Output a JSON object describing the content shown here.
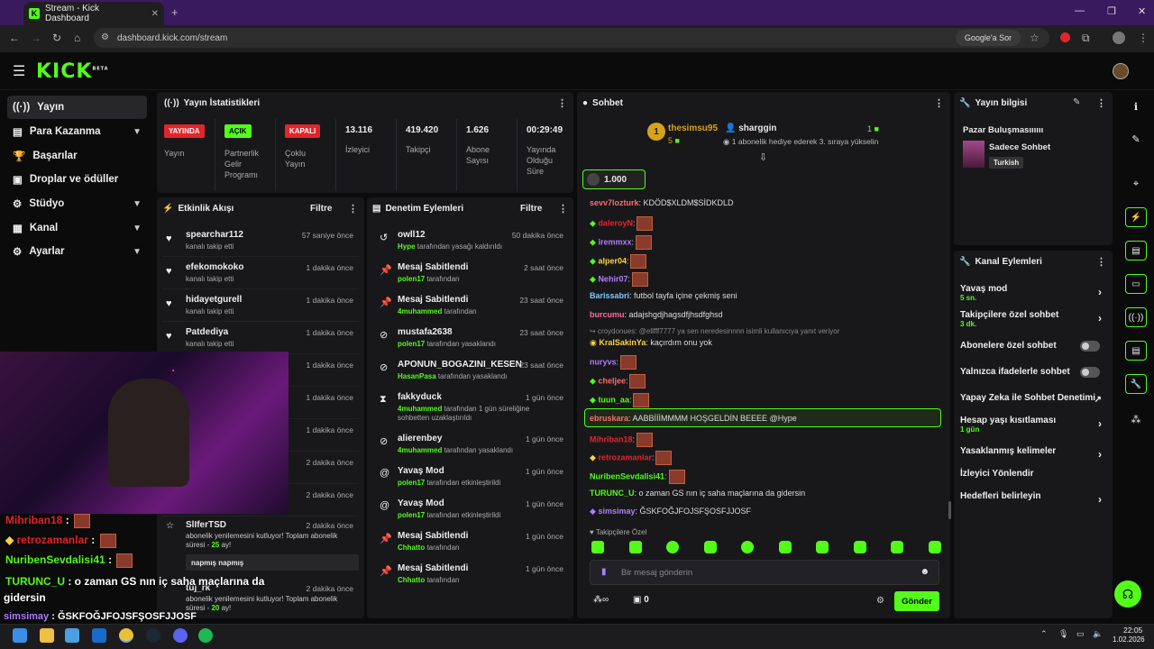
{
  "browser": {
    "tab_title": "Stream - Kick Dashboard",
    "url": "dashboard.kick.com/stream",
    "search_chip": "Google'a Sor"
  },
  "app": {
    "logo": "KICK",
    "logo_badge": "BETA"
  },
  "sidebar": {
    "items": [
      {
        "label": "Yayın",
        "icon": "broadcast-icon"
      },
      {
        "label": "Para Kazanma",
        "icon": "money-icon"
      },
      {
        "label": "Başarılar",
        "icon": "trophy-icon"
      },
      {
        "label": "Droplar ve ödüller",
        "icon": "gift-icon"
      },
      {
        "label": "Stüdyo",
        "icon": "studio-icon"
      },
      {
        "label": "Kanal",
        "icon": "channel-icon"
      },
      {
        "label": "Ayarlar",
        "icon": "gear-icon"
      }
    ]
  },
  "stats": {
    "title": "Yayın İstatistikleri",
    "badges": [
      {
        "value": "YAYINDA",
        "label": "Yayın",
        "color": "#e3252b"
      },
      {
        "value": "AÇIK",
        "label": "Partnerlik Gelir Programı",
        "color": "#53fc18"
      },
      {
        "value": "KAPALI",
        "label": "Çoklu Yayın",
        "color": "#e3252b"
      }
    ],
    "numbers": [
      {
        "value": "13.116",
        "label": "İzleyici"
      },
      {
        "value": "419.420",
        "label": "Takipçi"
      },
      {
        "value": "1.626",
        "label": "Abone Sayısı"
      },
      {
        "value": "00:29:49",
        "label": "Yayında Olduğu Süre"
      }
    ]
  },
  "activity": {
    "title": "Etkinlik Akışı",
    "filter": "Filtre",
    "items": [
      {
        "name": "spearchar112",
        "sub": "kanalı takip etti",
        "time": "57 saniye önce"
      },
      {
        "name": "efekomokoko",
        "sub": "kanalı takip etti",
        "time": "1 dakika önce"
      },
      {
        "name": "hidayetgurell",
        "sub": "kanalı takip etti",
        "time": "1 dakika önce"
      },
      {
        "name": "Patdediya",
        "sub": "kanalı takip etti",
        "time": "1 dakika önce"
      },
      {
        "name": "",
        "sub": "",
        "time": "1 dakika önce"
      },
      {
        "name": "",
        "sub": "",
        "time": "1 dakika önce"
      },
      {
        "name": "",
        "sub": "",
        "time": "1 dakika önce"
      },
      {
        "name": "",
        "sub": "",
        "time": "2 dakika önce"
      },
      {
        "name": "",
        "sub": "",
        "time": "2 dakika önce"
      }
    ],
    "resub1": {
      "name": "SlIferTSD",
      "time": "2 dakika önce",
      "text": "abonelik yenilemesini kutluyor! Toplam abonelik süresi - ",
      "months": "25",
      "suffix": " ay!",
      "message": "napmış napmış"
    },
    "resub2": {
      "name": "tuj_rk",
      "time": "2 dakika önce",
      "text": "abonelik yenilemesini kutluyor! Toplam abonelik süresi - ",
      "months": "20",
      "suffix": " ay!"
    }
  },
  "moderation": {
    "title": "Denetim Eylemleri",
    "filter": "Filtre",
    "items": [
      {
        "icon": "undo-icon",
        "name": "owll12",
        "actor": "Hype",
        "rest": " tarafından yasağı kaldırıldı",
        "time": "50 dakika önce"
      },
      {
        "icon": "pin-icon",
        "name": "Mesaj Sabitlendi",
        "actor": "polen17",
        "rest": " tarafından",
        "time": "2 saat önce"
      },
      {
        "icon": "pin-icon",
        "name": "Mesaj Sabitlendi",
        "actor": "4muhammed",
        "rest": " tarafından",
        "time": "23 saat önce"
      },
      {
        "icon": "ban-icon",
        "name": "mustafa2638",
        "actor": "polen17",
        "rest": " tarafından yasaklandı",
        "time": "23 saat önce"
      },
      {
        "icon": "ban-icon",
        "name": "APONUN_BOGAZINI_KESEN",
        "actor": "HasanPasa",
        "rest": " tarafından yasaklandı",
        "time": "23 saat önce"
      },
      {
        "icon": "hourglass-icon",
        "name": "fakkyduck",
        "actor": "4muhammed",
        "rest": " tarafından 1 gün süreliğine sohbetten uzaklaştırıldı",
        "time": "1 gün önce"
      },
      {
        "icon": "ban-icon",
        "name": "alierenbey",
        "actor": "4muhammed",
        "rest": " tarafından yasaklandı",
        "time": "1 gün önce"
      },
      {
        "icon": "snail-icon",
        "name": "Yavaş Mod",
        "actor": "polen17",
        "rest": " tarafından etkinleştirildi",
        "time": "1 gün önce"
      },
      {
        "icon": "snail-icon",
        "name": "Yavaş Mod",
        "actor": "polen17",
        "rest": " tarafından etkinleştirildi",
        "time": "1 gün önce"
      },
      {
        "icon": "pin-icon",
        "name": "Mesaj Sabitlendi",
        "actor": "Chhatto",
        "rest": " tarafından",
        "time": "1 gün önce"
      },
      {
        "icon": "pin-icon",
        "name": "Mesaj Sabitlendi",
        "actor": "Chhatto",
        "rest": " tarafından",
        "time": "1 gün önce"
      }
    ]
  },
  "chat": {
    "title": "Sohbet",
    "gifter_count": "1",
    "gifter_name": "thesimsu95",
    "gifter_sub": "5",
    "gift_user": "sharggin",
    "gift_count": "1",
    "gift_text": "1 abonelik hediye ederek 3. sıraya yükselin",
    "pinned_amount": "1.000",
    "messages": [
      {
        "user": "sevv7lozturk",
        "color": "#ff6b6b",
        "text": ": KDÖD$XLDM$SİDKDLD",
        "emote": false
      },
      {
        "user": "daleroyN",
        "color": "#e3252b",
        "text": ":",
        "emote": true
      },
      {
        "user": "iremmxx",
        "color": "#b07cff",
        "text": ":",
        "emote": true
      },
      {
        "user": "alper04",
        "color": "#ffd23f",
        "text": ":",
        "emote": true
      },
      {
        "user": "Nehir07",
        "color": "#b07cff",
        "text": ":",
        "emote": true
      },
      {
        "user": "Barissabri",
        "color": "#7ec8ff",
        "text": ": futbol tayfa içine çekmiş seni",
        "emote": false
      },
      {
        "user": "burcumu",
        "color": "#ff6b9a",
        "text": ": adajshgdjhagsdfjhsdfghsd",
        "emote": false
      },
      {
        "user": "KralSakinYa",
        "color": "#ffd23f",
        "text": ": kaçırdım onu yok",
        "emote": false,
        "reply": "croydonues: @ellfff7777 ya sen neredesinnnn isimli kullanıcıya yanıt veriyor"
      },
      {
        "user": "nuryvs",
        "color": "#b07cff",
        "text": ":",
        "emote": true
      },
      {
        "user": "cheljee",
        "color": "#ff6b6b",
        "text": ":",
        "emote": true
      },
      {
        "user": "tuun_aa",
        "color": "#53fc18",
        "text": ":",
        "emote": true
      },
      {
        "user": "ebruskara",
        "color": "#ff6b6b",
        "text": ": AABBİİİMMMM HOŞGELDİN BEEEE @Hype",
        "emote": false,
        "highlight": true
      },
      {
        "user": "Mihriban18",
        "color": "#e3252b",
        "text": ":",
        "emote": true
      },
      {
        "user": "retrozamanlar",
        "color": "#e3252b",
        "text": ":",
        "emote": true
      },
      {
        "user": "NuribenSevdalisi41",
        "color": "#53fc18",
        "text": ":",
        "emote": true
      },
      {
        "user": "TURUNC_U",
        "color": "#53fc18",
        "text": ": o zaman GS nın iç saha maçlarına da gidersin",
        "emote": false
      },
      {
        "user": "simsimay",
        "color": "#b07cff",
        "text": ": ĞSKFOĞJFOJSFŞOSFJJOSF",
        "emote": false
      }
    ],
    "followers_only": "Takipçilere Özel",
    "input_placeholder": "Bir mesaj gönderin",
    "count_value": "0",
    "send_label": "Gönder"
  },
  "stream_info": {
    "title": "Yayın bilgisi",
    "stream_title": "Pazar Buluşmasıııııı",
    "category": "Sadece Sohbet",
    "tag": "Turkish"
  },
  "channel_actions": {
    "title": "Kanal Eylemleri",
    "rows": [
      {
        "label": "Yavaş mod",
        "sub": "5 sn.",
        "control": "chevron"
      },
      {
        "label": "Takipçilere özel sohbet",
        "sub": "3 dk.",
        "control": "chevron"
      },
      {
        "label": "Abonelere özel sohbet",
        "sub": "",
        "control": "toggle"
      },
      {
        "label": "Yalnızca ifadelerle sohbet",
        "sub": "",
        "control": "toggle"
      },
      {
        "label": "Yapay Zeka ile Sohbet Denetimi",
        "sub": "",
        "control": "external"
      },
      {
        "label": "Hesap yaşı kısıtlaması",
        "sub": "1 gün",
        "control": "chevron"
      },
      {
        "label": "Yasaklanmış kelimeler",
        "sub": "",
        "control": "chevron"
      },
      {
        "label": "İzleyici Yönlendir",
        "sub": "",
        "control": "none"
      },
      {
        "label": "Hedefleri belirleyin",
        "sub": "",
        "control": "chevron"
      }
    ]
  },
  "overlay": {
    "lines": [
      {
        "user": "Mihriban18",
        "text": ":",
        "color": "#e3252b"
      },
      {
        "user": "retrozamanlar",
        "text": ":",
        "color": "#e3252b"
      },
      {
        "user": "NuribenSevdalisi41",
        "text": ":",
        "color": "#53fc18"
      },
      {
        "user": "TURUNC_U",
        "text": ": o zaman GS nın iç saha maçlarına da",
        "color": "#53fc18"
      },
      {
        "user": "",
        "text": "gidersin",
        "color": "#ffffff"
      },
      {
        "user": "simsimay",
        "text": ": ĞSKFOĞJFOJSFŞOSFJJOSF",
        "color": "#b07cff"
      }
    ]
  },
  "taskbar": {
    "time": "22:05",
    "date": "1.02.2026"
  },
  "colors": {
    "accent": "#53fc18",
    "live": "#e3252b",
    "panel": "#18181b",
    "browser_tab": "#3a1a5e"
  }
}
